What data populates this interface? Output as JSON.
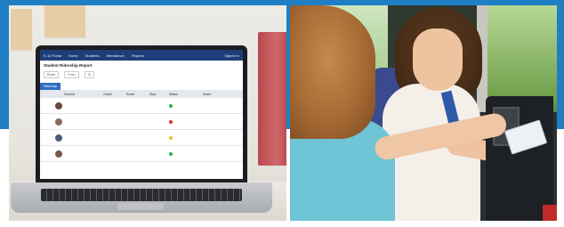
{
  "colors": {
    "band": "#1f7fc4",
    "app_header": "#1d3e7a",
    "tab_accent": "#2f6cc3",
    "status_green": "#2bb24c",
    "status_red": "#d9342b",
    "status_yellow": "#e6c229"
  },
  "screen": {
    "header_items": [
      "K-12 Portal",
      "Home",
      "Students",
      "Attendance",
      "Reports"
    ],
    "header_right": "Signed in",
    "title": "Student Ridership Report",
    "filters": [
      "Route",
      "From",
      "To"
    ],
    "tab": "Ridership",
    "columns": [
      "",
      "",
      "Student",
      "Grade",
      "Route",
      "Stop",
      "Status",
      "",
      "Notes"
    ],
    "rows": [
      {
        "avatar_color": "#6b4a3a",
        "status": "green"
      },
      {
        "avatar_color": "#8a6a58",
        "status": "red"
      },
      {
        "avatar_color": "#4e5b7a",
        "status": "yellow"
      },
      {
        "avatar_color": "#7a5a48",
        "status": "green"
      }
    ]
  },
  "icons": [
    "laptop-icon",
    "fare-card-icon"
  ]
}
